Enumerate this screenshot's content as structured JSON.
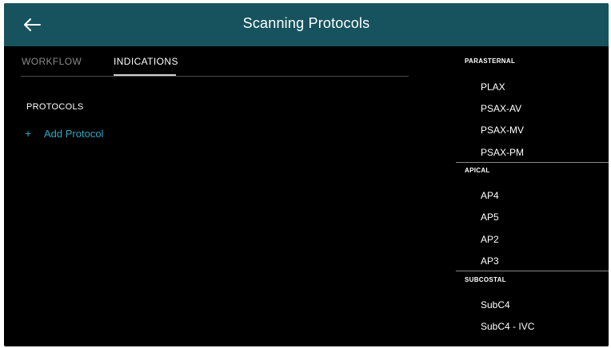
{
  "header": {
    "title": "Scanning Protocols",
    "back_icon": "arrow-left-icon",
    "background_color": "#16535f"
  },
  "tabs": [
    {
      "label": "WORKFLOW",
      "selected": false
    },
    {
      "label": "INDICATIONS",
      "selected": true
    }
  ],
  "protocols": {
    "section_label": "PROTOCOLS",
    "add_icon": "plus-icon",
    "add_label": "Add Protocol",
    "accent_color": "#2fa7c2"
  },
  "views": [
    {
      "header": "PARASTERNAL",
      "items": [
        "PLAX",
        "PSAX-AV",
        "PSAX-MV",
        "PSAX-PM"
      ]
    },
    {
      "header": "APICAL",
      "items": [
        "AP4",
        "AP5",
        "AP2",
        "AP3"
      ]
    },
    {
      "header": "SUBCOSTAL",
      "items": [
        "SubC4",
        "SubC4 - IVC"
      ]
    }
  ]
}
